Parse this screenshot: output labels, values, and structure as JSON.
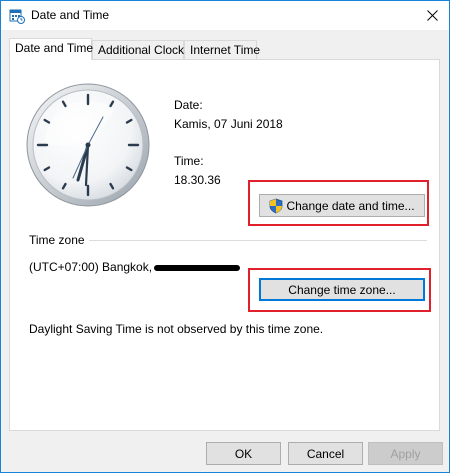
{
  "window": {
    "title": "Date and Time"
  },
  "tabs": [
    {
      "label": "Date and Time",
      "active": true
    },
    {
      "label": "Additional Clocks",
      "active": false
    },
    {
      "label": "Internet Time",
      "active": false
    }
  ],
  "date": {
    "label": "Date:",
    "value": "Kamis, 07 Juni 2018"
  },
  "time": {
    "label": "Time:",
    "value": "18.30.36"
  },
  "buttons": {
    "change_date_time": "Change date and time...",
    "change_time_zone": "Change time zone...",
    "ok": "OK",
    "cancel": "Cancel",
    "apply": "Apply"
  },
  "timezone": {
    "heading": "Time zone",
    "value": "(UTC+07:00) Bangkok,",
    "dst_note": "Daylight Saving Time is not observed by this time zone."
  },
  "colors": {
    "highlight": "#e0212b",
    "focus": "#0078d7"
  },
  "icons": [
    "datetime-app-icon",
    "close-icon",
    "uac-shield-icon"
  ]
}
